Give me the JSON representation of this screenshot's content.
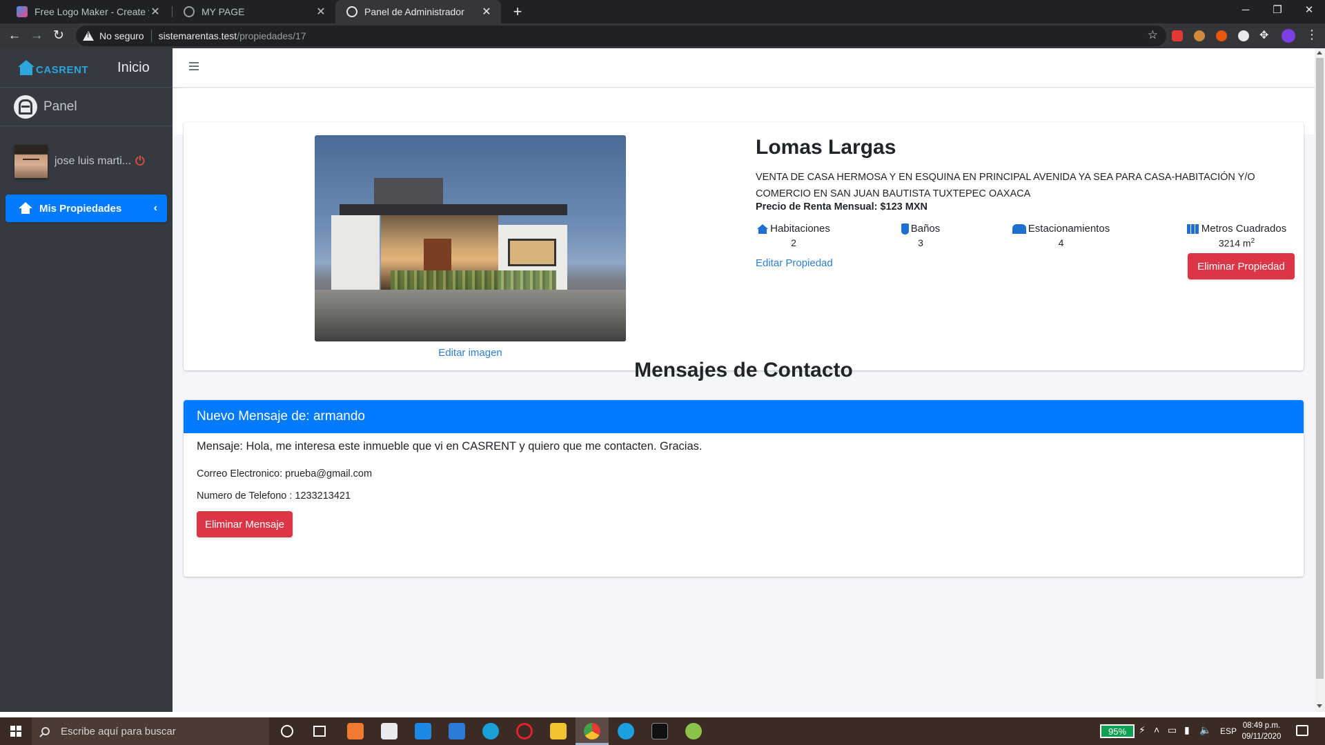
{
  "browser": {
    "tabs": [
      {
        "title": "Free Logo Maker - Create your o",
        "active": false
      },
      {
        "title": "MY PAGE",
        "active": false
      },
      {
        "title": "Panel de Administrador",
        "active": true
      }
    ],
    "security_label": "No seguro",
    "url_host": "sistemarentas.test",
    "url_path": "/propiedades/17"
  },
  "sidebar": {
    "brand_text": "CASRENT",
    "home_link": "Inicio",
    "panel_label": "Panel",
    "user_name": "jose luis marti...",
    "nav_items": [
      {
        "label": "Mis Propiedades",
        "active": true
      }
    ]
  },
  "property": {
    "title": "Lomas Largas",
    "description": "VENTA DE CASA HERMOSA Y EN ESQUINA EN PRINCIPAL AVENIDA YA SEA PARA CASA-HABITACIÓN Y/O COMERCIO EN SAN JUAN BAUTISTA TUXTEPEC OAXACA",
    "price": "Precio de Renta Mensual: $123 MXN",
    "edit_image_label": "Editar imagen",
    "edit_property_label": "Editar Propiedad",
    "delete_property_label": "Eliminar Propiedad",
    "features": [
      {
        "label": "Habitaciones",
        "value": "2",
        "icon": "house-icon"
      },
      {
        "label": "Baños",
        "value": "3",
        "icon": "toilet-icon"
      },
      {
        "label": "Estacionamientos",
        "value": "4",
        "icon": "garage-icon"
      },
      {
        "label": "Metros Cuadrados",
        "value": "3214 m",
        "unit_sup": "2",
        "icon": "map-icon"
      }
    ]
  },
  "messages": {
    "section_title": "Mensajes de Contacto",
    "items": [
      {
        "header": "Nuevo Mensaje de: armando",
        "body": "Mensaje: Hola, me interesa este inmueble que vi en CASRENT y quiero que me contacten. Gracias.",
        "email": "Correo Electronico: prueba@gmail.com",
        "phone": "Numero de Telefono : 1233213421",
        "delete_label": "Eliminar Mensaje"
      }
    ]
  },
  "taskbar": {
    "search_placeholder": "Escribe aquí para buscar",
    "battery": "95%",
    "language": "ESP",
    "time": "08:49 p.m.",
    "date": "09/11/2020"
  },
  "colors": {
    "primary": "#007bff",
    "danger": "#dc3545",
    "sidebar_bg": "#343a40",
    "link": "#2f7fd1"
  }
}
